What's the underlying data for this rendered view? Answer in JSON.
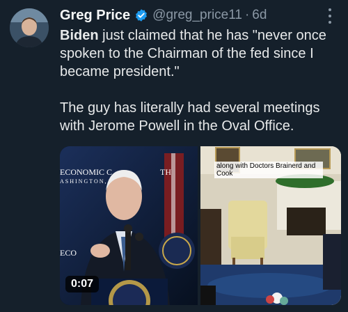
{
  "author": {
    "name": "Greg Price",
    "handle": "@greg_price11",
    "separator": "·",
    "time": "6d"
  },
  "tweet": {
    "line1_bold": "Biden",
    "line1_rest": " just claimed that he has \"never once spoken to the Chairman of the fed since I became president.\"",
    "line2": "The guy has literally had several meetings with Jerome Powell in the Oval Office."
  },
  "media": {
    "duration": "0:07",
    "caption": "along with Doctors Brainerd and Cook",
    "backdrop_text_1": "ECONOMIC C",
    "backdrop_text_2": "ASHINGTON,",
    "backdrop_text_3": "TH",
    "backdrop_text_4": "ECO"
  },
  "colors": {
    "background": "#15202b",
    "verified": "#1d9bf0",
    "secondary_text": "#8b98a5"
  }
}
